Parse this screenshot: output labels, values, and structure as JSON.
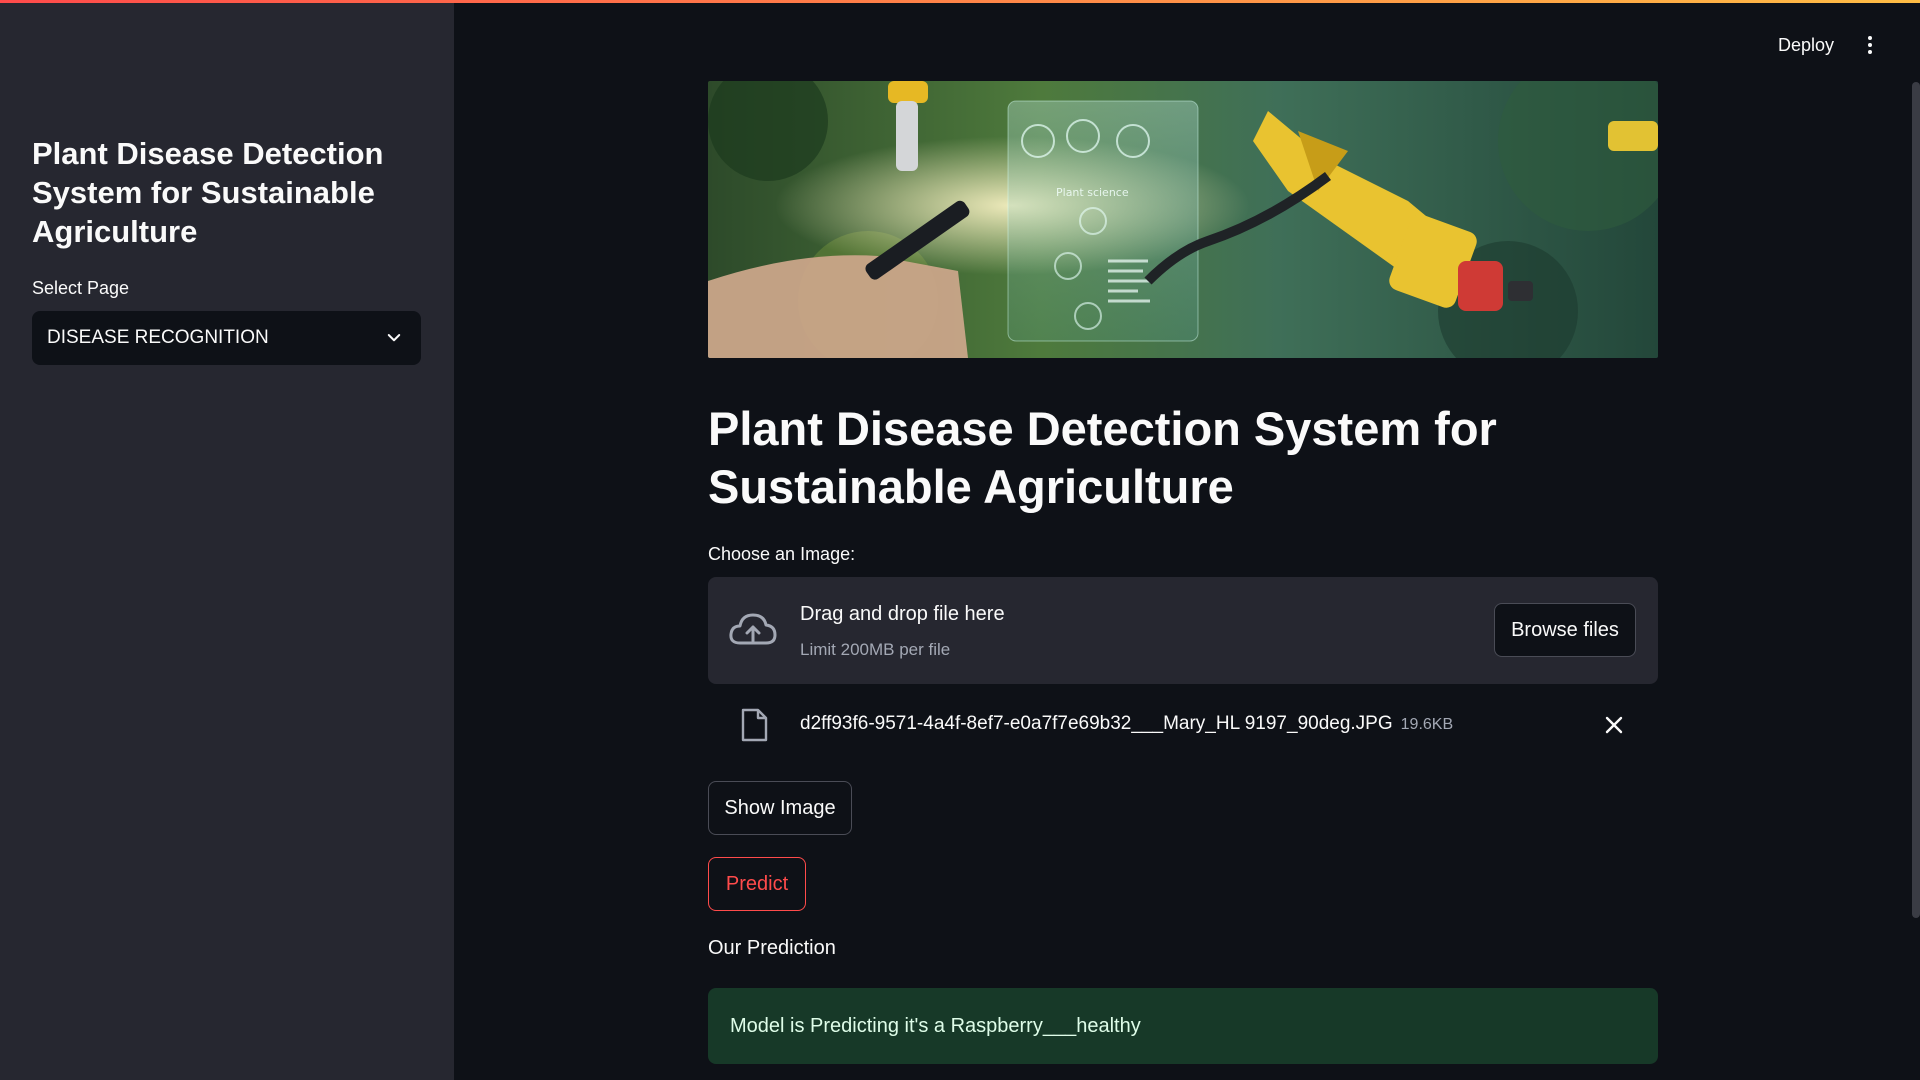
{
  "sidebar": {
    "title": "Plant Disease Detection System for Sustainable Agriculture",
    "select_label": "Select Page",
    "select_value": "DISEASE RECOGNITION"
  },
  "header": {
    "deploy_label": "Deploy"
  },
  "main": {
    "banner_text": "Plant science",
    "title": "Plant Disease Detection System for Sustainable Agriculture",
    "uploader": {
      "label": "Choose an Image:",
      "drag_text": "Drag and drop file here",
      "limit_text": "Limit 200MB per file",
      "browse_label": "Browse files"
    },
    "file": {
      "name": "d2ff93f6-9571-4a4f-8ef7-e0a7f7e69b32___Mary_HL 9197_90deg.JPG",
      "size": "19.6KB"
    },
    "show_image_label": "Show Image",
    "predict_label": "Predict",
    "prediction_heading": "Our Prediction",
    "prediction_result": "Model is Predicting it's a Raspberry___healthy"
  },
  "colors": {
    "accent": "#ff4b4b",
    "background": "#0e1117",
    "sidebar": "#262730",
    "success": "#173928"
  },
  "icons": [
    "chevron-down-icon",
    "kebab-menu-icon",
    "cloud-upload-icon",
    "file-icon",
    "close-icon"
  ]
}
